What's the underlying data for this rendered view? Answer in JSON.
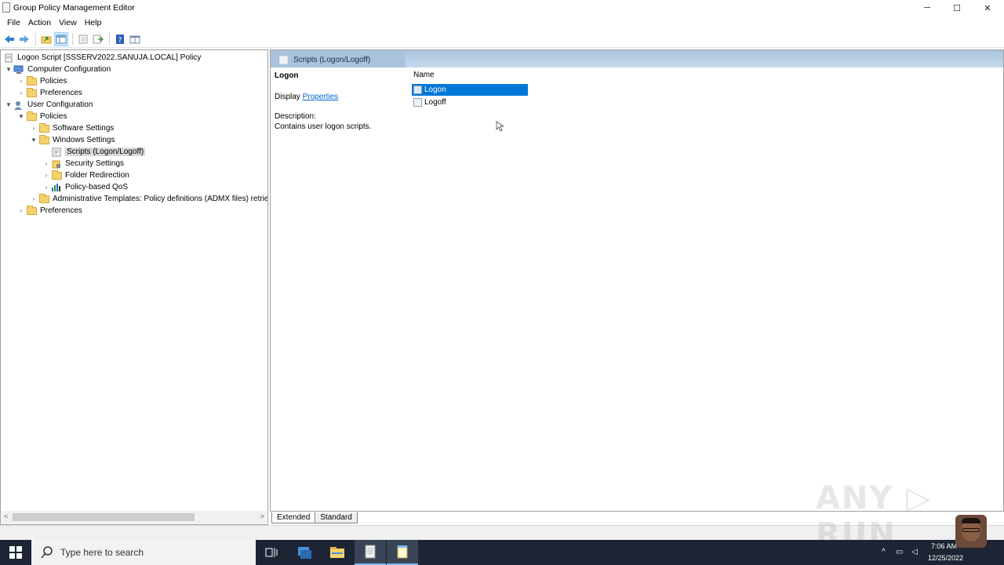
{
  "window": {
    "title": "Group Policy Management Editor",
    "minimize": "─",
    "maximize": "☐",
    "close": "✕"
  },
  "menu": [
    "File",
    "Action",
    "View",
    "Help"
  ],
  "tree": {
    "items": [
      {
        "label": "Logon Script [SSSERV2022.SANUJA.LOCAL] Policy",
        "icon": "policy-icon"
      },
      {
        "label": "Computer Configuration",
        "icon": "computer-icon"
      },
      {
        "label": "Policies",
        "icon": "folder-icon"
      },
      {
        "label": "Preferences",
        "icon": "folder-icon"
      },
      {
        "label": "User Configuration",
        "icon": "user-icon"
      },
      {
        "label": "Policies",
        "icon": "folder-icon"
      },
      {
        "label": "Software Settings",
        "icon": "folder-icon"
      },
      {
        "label": "Windows Settings",
        "icon": "folder-icon"
      },
      {
        "label": "Scripts (Logon/Logoff)",
        "icon": "scripts-icon"
      },
      {
        "label": "Security Settings",
        "icon": "security-icon"
      },
      {
        "label": "Folder Redirection",
        "icon": "folder-icon"
      },
      {
        "label": "Policy-based QoS",
        "icon": "chart-icon"
      },
      {
        "label": "Administrative Templates: Policy definitions (ADMX files) retrieved",
        "icon": "folder-icon"
      },
      {
        "label": "Preferences",
        "icon": "folder-icon"
      }
    ],
    "scroll_left": "<",
    "scroll_right": ">"
  },
  "details": {
    "header_tab": "Scripts (Logon/Logoff)",
    "extended_title": "Logon",
    "display_prefix": "Display ",
    "properties_link": "Properties",
    "description_label": "Description:",
    "description_text": "Contains user logon scripts.",
    "column_name": "Name",
    "rows": [
      {
        "label": "Logon",
        "selected": true
      },
      {
        "label": "Logoff",
        "selected": false
      }
    ]
  },
  "bottom_tabs": {
    "extended": "Extended",
    "standard": "Standard"
  },
  "taskbar": {
    "search_placeholder": "Type here to search",
    "time": "7:06 AM",
    "date": "12/25/2022"
  },
  "watermark": "ANY ▷ RUN",
  "colors": {
    "selection": "#0078d7",
    "taskbar": "#1d2433",
    "link": "#0066cc"
  }
}
